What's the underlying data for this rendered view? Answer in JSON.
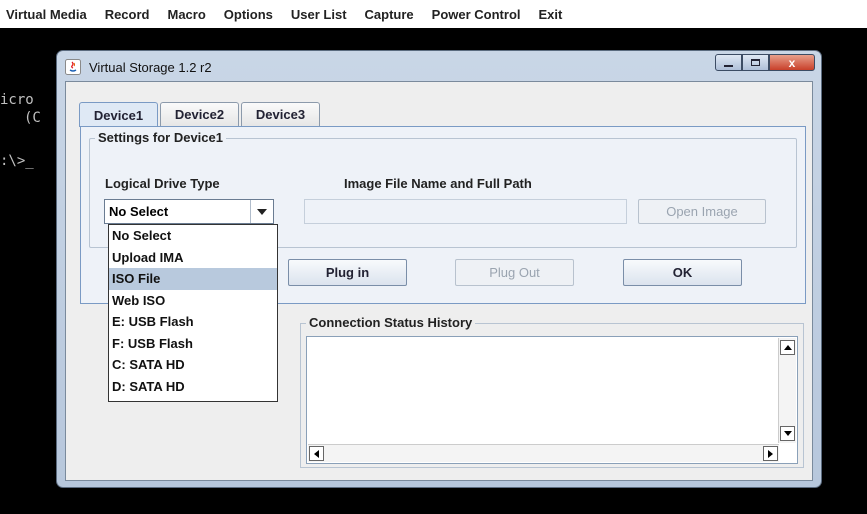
{
  "menu": [
    "Virtual Media",
    "Record",
    "Macro",
    "Options",
    "User List",
    "Capture",
    "Power Control",
    "Exit"
  ],
  "console": {
    "line1": "icro",
    "line2": "(C",
    "line3": ":\\>_"
  },
  "window": {
    "title": "Virtual Storage 1.2 r2",
    "close_glyph": "x"
  },
  "tabs": [
    "Device1",
    "Device2",
    "Device3"
  ],
  "settings": {
    "group_label": "Settings for Device1",
    "drive_type_label": "Logical Drive Type",
    "drive_type_value": "No Select",
    "image_path_label": "Image File Name and Full Path",
    "image_path_value": "",
    "open_image_label": "Open Image"
  },
  "buttons": {
    "plug_in": "Plug in",
    "plug_out": "Plug Out",
    "ok": "OK"
  },
  "dropdown": {
    "options": [
      "No Select",
      "Upload IMA",
      "ISO File",
      "Web ISO",
      "E: USB Flash",
      "F: USB Flash",
      "C: SATA HD",
      "D: SATA HD"
    ],
    "highlighted": "ISO File"
  },
  "history": {
    "label": "Connection Status History"
  },
  "colors": {
    "highlight": "#b8c9dd",
    "tab_border": "#7a9ac4",
    "close_button": "#c8402a"
  }
}
